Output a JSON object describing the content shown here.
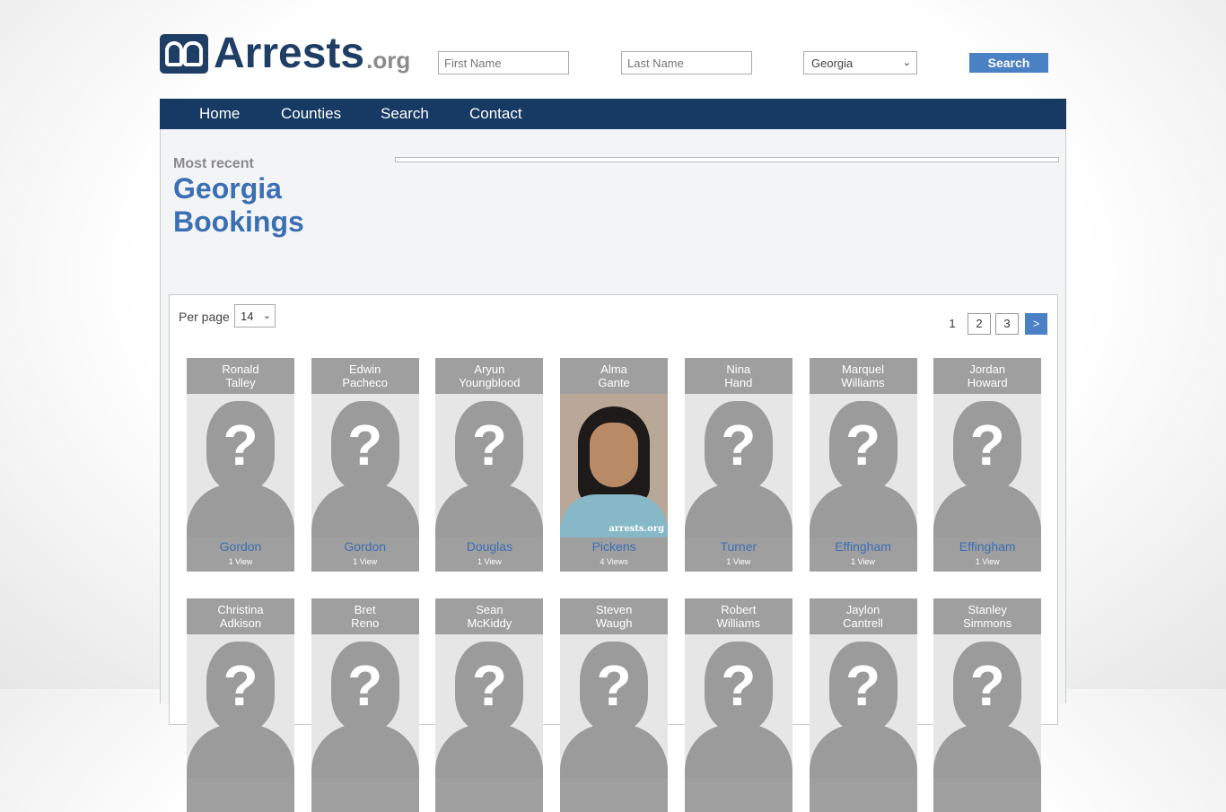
{
  "header": {
    "logo_text": "Arrests",
    "logo_suffix": ".org",
    "first_name_placeholder": "First Name",
    "last_name_placeholder": "Last Name",
    "state_selected": "Georgia",
    "search_label": "Search"
  },
  "nav": {
    "items": [
      "Home",
      "Counties",
      "Search",
      "Contact"
    ]
  },
  "main": {
    "kicker": "Most recent",
    "title_line1": "Georgia",
    "title_line2": "Bookings"
  },
  "listing": {
    "per_page_label": "Per page",
    "per_page_value": "14",
    "pagination": {
      "current": "1",
      "pages": [
        "2",
        "3"
      ],
      "next": ">"
    },
    "cards": [
      {
        "first": "Ronald",
        "last": "Talley",
        "county": "Gordon",
        "views": "1 View",
        "photo": "placeholder"
      },
      {
        "first": "Edwin",
        "last": "Pacheco",
        "county": "Gordon",
        "views": "1 View",
        "photo": "placeholder"
      },
      {
        "first": "Aryun",
        "last": "Youngblood",
        "county": "Douglas",
        "views": "1 View",
        "photo": "placeholder"
      },
      {
        "first": "Alma",
        "last": "Gante",
        "county": "Pickens",
        "views": "4 Views",
        "photo": "mugshot",
        "watermark": "arrests.org"
      },
      {
        "first": "Nina",
        "last": "Hand",
        "county": "Turner",
        "views": "1 View",
        "photo": "placeholder"
      },
      {
        "first": "Marquel",
        "last": "Williams",
        "county": "Effingham",
        "views": "1 View",
        "photo": "placeholder"
      },
      {
        "first": "Jordan",
        "last": "Howard",
        "county": "Effingham",
        "views": "1 View",
        "photo": "placeholder"
      },
      {
        "first": "Christina",
        "last": "Adkison",
        "county": "",
        "views": "",
        "photo": "placeholder"
      },
      {
        "first": "Bret",
        "last": "Reno",
        "county": "",
        "views": "",
        "photo": "placeholder"
      },
      {
        "first": "Sean",
        "last": "McKiddy",
        "county": "",
        "views": "",
        "photo": "placeholder"
      },
      {
        "first": "Steven",
        "last": "Waugh",
        "county": "",
        "views": "",
        "photo": "placeholder"
      },
      {
        "first": "Robert",
        "last": "Williams",
        "county": "",
        "views": "",
        "photo": "placeholder"
      },
      {
        "first": "Jaylon",
        "last": "Cantrell",
        "county": "",
        "views": "",
        "photo": "placeholder"
      },
      {
        "first": "Stanley",
        "last": "Simmons",
        "county": "",
        "views": "",
        "photo": "placeholder"
      }
    ]
  },
  "colors": {
    "brand_navy": "#163a63",
    "accent_blue": "#3b6fb3",
    "button_blue": "#4a80c4"
  }
}
